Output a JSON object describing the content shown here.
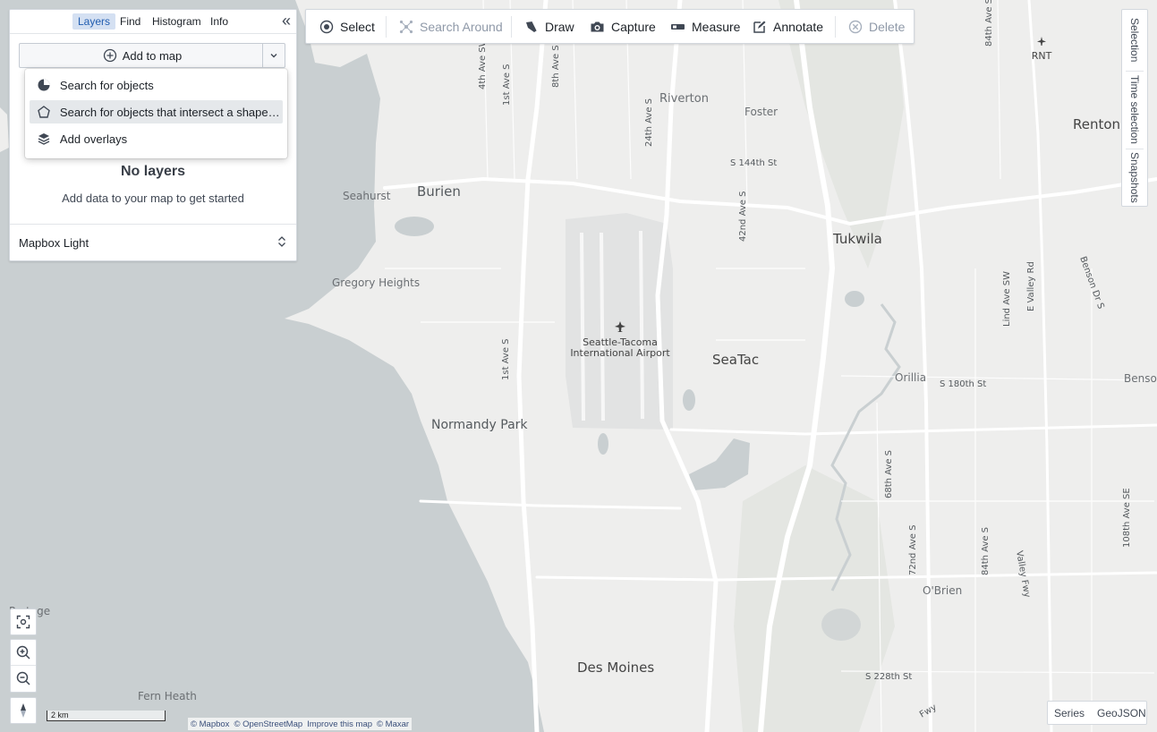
{
  "panel": {
    "tabs": [
      "Layers",
      "Find",
      "Histogram",
      "Info"
    ],
    "active_tab": "Layers",
    "add_to_map_label": "Add to map",
    "menu_items": [
      {
        "label": "Search for objects",
        "icon": "object-search-icon"
      },
      {
        "label": "Search for objects that intersect a shape…",
        "icon": "polygon-icon",
        "highlighted": true
      },
      {
        "label": "Add overlays",
        "icon": "layers-icon"
      }
    ],
    "empty_title": "No layers",
    "empty_subtitle": "Add data to your map to get started",
    "basemap": "Mapbox Light"
  },
  "toolbar": {
    "select": "Select",
    "search_around": "Search Around",
    "draw": "Draw",
    "capture": "Capture",
    "measure": "Measure",
    "annotate": "Annotate",
    "delete": "Delete"
  },
  "right_rail": [
    "Selection",
    "Time selection",
    "Snapshots"
  ],
  "bottom_tabs": [
    "Series",
    "GeoJSON"
  ],
  "scale_label": "2 km",
  "attribution": [
    "© Mapbox",
    "© OpenStreetMap",
    "Improve this map",
    "© Maxar"
  ],
  "map": {
    "places": {
      "burien": "Burien",
      "seahurst": "Seahurst",
      "gregory_heights": "Gregory Heights",
      "normandy_park": "Normandy Park",
      "des_moines": "Des Moines",
      "fern_heath": "Fern Heath",
      "riverton": "Riverton",
      "foster": "Foster",
      "tukwila": "Tukwila",
      "renton": "Renton",
      "seatac": "SeaTac",
      "orillia": "Orillia",
      "obrien": "O'Brien",
      "benson": "Benso",
      "portage": "Portage",
      "airport_line1": "Seattle-Tacoma",
      "airport_line2": "International Airport",
      "rnt": "RNT"
    },
    "streets": {
      "s144": "S 144th St",
      "s180": "S 180th St",
      "s228": "S 228th St",
      "ave4": "4th Ave SW",
      "ave1n": "1st Ave S",
      "ave8": "8th Ave S",
      "ave24": "24th Ave S",
      "ave42": "42nd Ave S",
      "ave1s": "1st Ave S",
      "ave68": "68th Ave S",
      "ave72": "72nd Ave S",
      "ave84s": "84th Ave S",
      "ave84n": "84th Ave S",
      "lind": "Lind Ave SW",
      "evalley": "E Valley Rd",
      "benson_dr": "Benson Dr S",
      "ave108": "108th Ave SE",
      "valleyfwy": "Valley Fwy",
      "fwy": "Fwy"
    }
  }
}
